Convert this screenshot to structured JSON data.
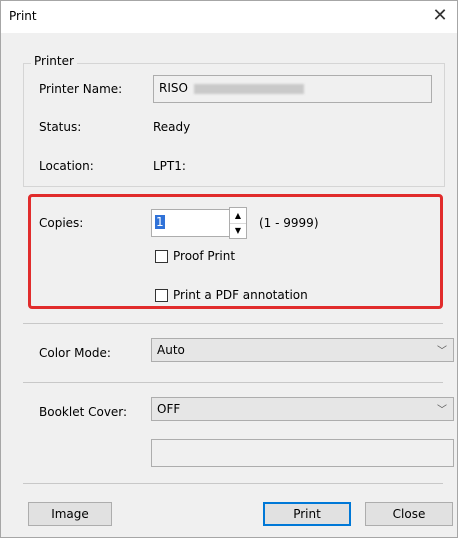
{
  "window": {
    "title": "Print",
    "close_glyph": "✕"
  },
  "printer": {
    "group_label": "Printer",
    "name_label": "Printer Name:",
    "name_value": "RISO",
    "status_label": "Status:",
    "status_value": "Ready",
    "location_label": "Location:",
    "location_value": "LPT1:"
  },
  "copies": {
    "label": "Copies:",
    "value": "1",
    "range": "(1 - 9999)"
  },
  "options": {
    "proof_print_label": "Proof Print",
    "pdf_annotation_label": "Print a PDF annotation"
  },
  "color_mode": {
    "label": "Color Mode:",
    "value": "Auto"
  },
  "booklet_cover": {
    "label": "Booklet Cover:",
    "value": "OFF"
  },
  "buttons": {
    "image": "Image",
    "print": "Print",
    "close": "Close"
  },
  "colors": {
    "highlight": "#e12c2c",
    "accent": "#0078d7"
  }
}
